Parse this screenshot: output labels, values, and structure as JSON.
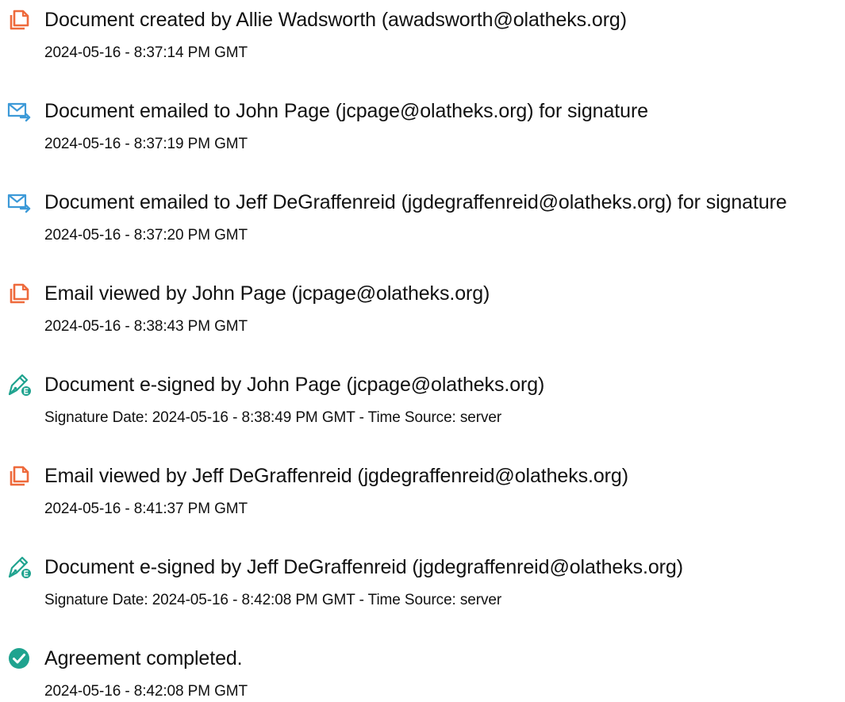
{
  "colors": {
    "doc_icon": "#ee6a3c",
    "email_icon": "#3d9ad8",
    "sign_icon": "#1fa38f",
    "complete_icon": "#1fa38f",
    "text": "#111111"
  },
  "events": [
    {
      "icon": "document-icon",
      "title": "Document created by Allie Wadsworth (awadsworth@olatheks.org)",
      "detail": "2024-05-16 - 8:37:14 PM GMT"
    },
    {
      "icon": "email-send-icon",
      "title": "Document emailed to John Page (jcpage@olatheks.org) for signature",
      "detail": "2024-05-16 - 8:37:19 PM GMT"
    },
    {
      "icon": "email-send-icon",
      "title": "Document emailed to Jeff DeGraffenreid (jgdegraffenreid@olatheks.org) for signature",
      "detail": "2024-05-16 - 8:37:20 PM GMT"
    },
    {
      "icon": "document-icon",
      "title": "Email viewed by John Page (jcpage@olatheks.org)",
      "detail": "2024-05-16 - 8:38:43 PM GMT"
    },
    {
      "icon": "pen-sign-icon",
      "title": "Document e-signed by John Page (jcpage@olatheks.org)",
      "detail": "Signature Date: 2024-05-16 - 8:38:49 PM GMT - Time Source: server"
    },
    {
      "icon": "document-icon",
      "title": "Email viewed by Jeff DeGraffenreid (jgdegraffenreid@olatheks.org)",
      "detail": "2024-05-16 - 8:41:37 PM GMT"
    },
    {
      "icon": "pen-sign-icon",
      "title": "Document e-signed by Jeff DeGraffenreid (jgdegraffenreid@olatheks.org)",
      "detail": "Signature Date: 2024-05-16 - 8:42:08 PM GMT - Time Source: server"
    },
    {
      "icon": "check-circle-icon",
      "title": "Agreement completed.",
      "detail": "2024-05-16 - 8:42:08 PM GMT"
    }
  ]
}
